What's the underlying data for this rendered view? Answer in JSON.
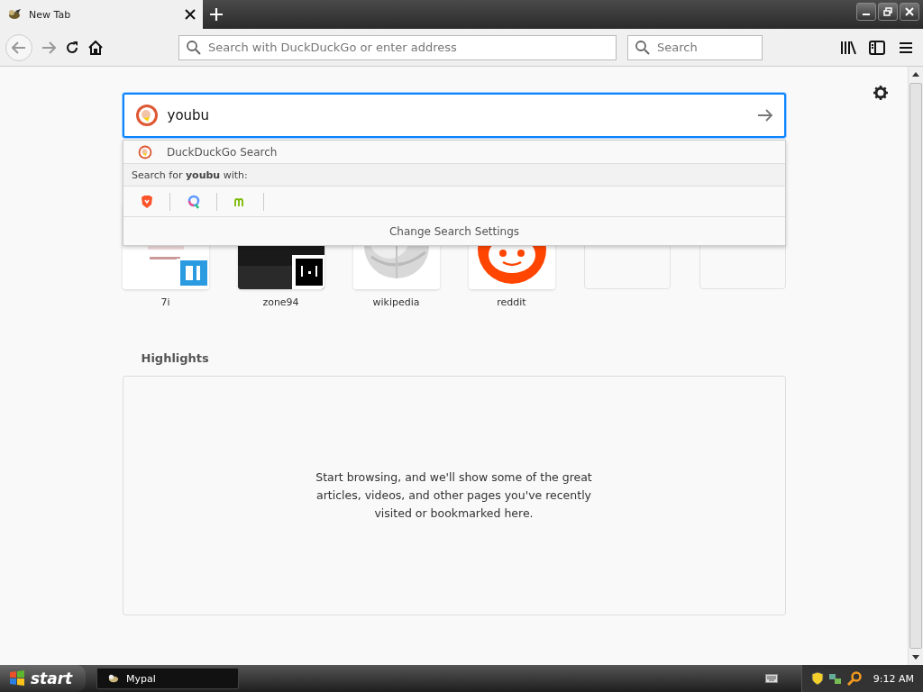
{
  "tab": {
    "title": "New Tab"
  },
  "toolbar": {
    "address_placeholder": "Search with DuckDuckGo or enter address",
    "search_placeholder": "Search"
  },
  "search": {
    "value": "youbu"
  },
  "dropdown": {
    "suggestion": "DuckDuckGo Search",
    "search_for": "Search for **youbu** with:",
    "engines": [
      {
        "kind": "brave"
      },
      {
        "kind": "qwant"
      },
      {
        "kind": "mojeek"
      }
    ],
    "settings": "Change Search Settings"
  },
  "top_sites": [
    {
      "kind": "site",
      "label": "7i"
    },
    {
      "kind": "site",
      "label": "zone94"
    },
    {
      "kind": "site",
      "label": "wikipedia"
    },
    {
      "kind": "site",
      "label": "reddit"
    },
    {
      "kind": "empty"
    },
    {
      "kind": "empty"
    }
  ],
  "highlights": {
    "title": "Highlights",
    "message": "Start browsing, and we'll show some of the great articles, videos, and other pages you've recently visited or bookmarked here."
  },
  "taskbar": {
    "start": "start",
    "tasks": [
      {
        "label": "Mypal"
      }
    ],
    "clock": "9:12 AM"
  }
}
